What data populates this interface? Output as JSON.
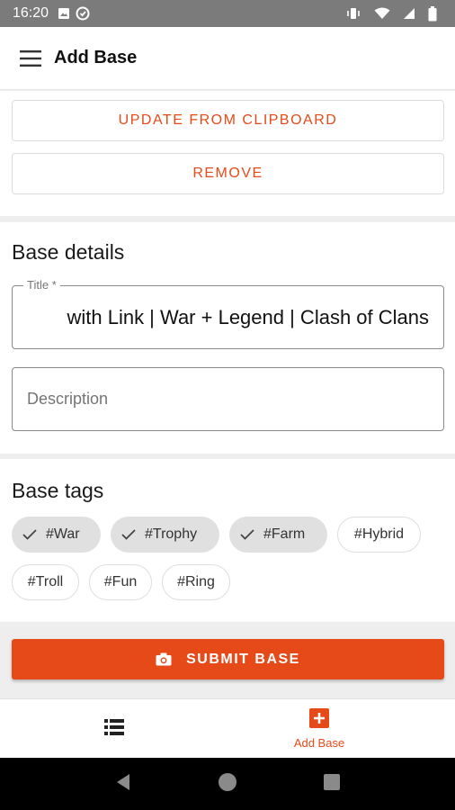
{
  "status_bar": {
    "time": "16:20"
  },
  "app_bar": {
    "title": "Add Base"
  },
  "actions": {
    "update_label": "UPDATE FROM CLIPBOARD",
    "remove_label": "REMOVE"
  },
  "base_details": {
    "heading": "Base details",
    "title_label": "Title *",
    "title_value": "with Link | War + Legend | Clash of Clans",
    "description_placeholder": "Description"
  },
  "base_tags": {
    "heading": "Base tags",
    "tags": [
      {
        "label": "#War",
        "selected": true
      },
      {
        "label": "#Trophy",
        "selected": true
      },
      {
        "label": "#Farm",
        "selected": true
      },
      {
        "label": "#Hybrid",
        "selected": false
      },
      {
        "label": "#Troll",
        "selected": false
      },
      {
        "label": "#Fun",
        "selected": false
      },
      {
        "label": "#Ring",
        "selected": false
      }
    ]
  },
  "submit": {
    "label": "SUBMIT BASE"
  },
  "bottom_nav": {
    "add_label": "Add Base"
  },
  "colors": {
    "accent": "#e64a19",
    "status_bar": "#7b7b7b",
    "chip_selected": "#e0e0e0"
  },
  "icons": [
    "menu-icon",
    "camera-icon",
    "list-icon",
    "add-box-icon",
    "check-icon",
    "image-icon",
    "wifi-icon",
    "battery-icon"
  ]
}
